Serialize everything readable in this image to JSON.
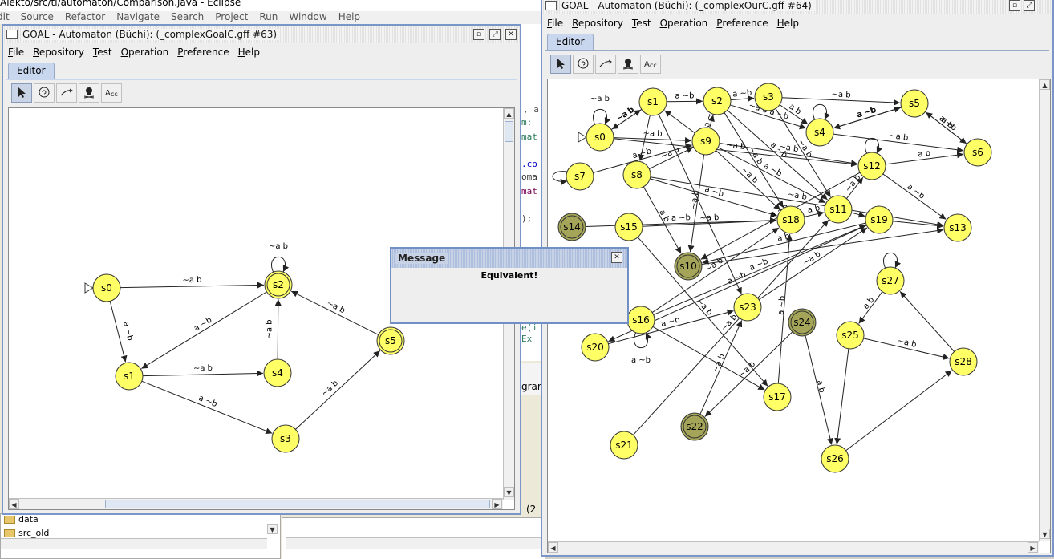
{
  "eclipse": {
    "title": "Alekto/src/tl/automaton/Comparison.java - Eclipse",
    "menu": [
      "dit",
      "Source",
      "Refactor",
      "Navigate",
      "Search",
      "Project",
      "Run",
      "Window",
      "Help"
    ],
    "code_fragments": [
      ", a",
      "m:",
      "mat",
      ".co",
      "oma",
      "mat",
      ");",
      "e(i",
      "Ex"
    ],
    "explorer_items": [
      "data",
      "src_old"
    ],
    "console_tab": "gram",
    "status_fragment": "(2"
  },
  "left_window": {
    "title": "GOAL - Automaton (Büchi): (_complexGoalC.gff #63)",
    "menu": [
      "File",
      "Repository",
      "Test",
      "Operation",
      "Preference",
      "Help"
    ],
    "tab": "Editor",
    "tools": [
      "pointer-icon",
      "state-icon",
      "transition-icon",
      "skull-icon",
      "text-tool-icon"
    ],
    "graph": {
      "states": [
        {
          "id": "s0",
          "initial": true,
          "accepting": false
        },
        {
          "id": "s1",
          "initial": false,
          "accepting": false
        },
        {
          "id": "s2",
          "initial": false,
          "accepting": true
        },
        {
          "id": "s3",
          "initial": false,
          "accepting": false
        },
        {
          "id": "s4",
          "initial": false,
          "accepting": false
        },
        {
          "id": "s5",
          "initial": false,
          "accepting": true
        }
      ],
      "transitions": [
        {
          "from": "s0",
          "to": "s2",
          "label": "~a b"
        },
        {
          "from": "s0",
          "to": "s1",
          "label": "a ~b"
        },
        {
          "from": "s2",
          "to": "s2",
          "label": "~a b"
        },
        {
          "from": "s2",
          "to": "s1",
          "label": "a ~b"
        },
        {
          "from": "s1",
          "to": "s4",
          "label": "~a b"
        },
        {
          "from": "s4",
          "to": "s2",
          "label": "~a b"
        },
        {
          "from": "s1",
          "to": "s3",
          "label": "a ~b"
        },
        {
          "from": "s3",
          "to": "s5",
          "label": "~a b"
        },
        {
          "from": "s5",
          "to": "s2",
          "label": "~a b"
        }
      ]
    }
  },
  "message_dialog": {
    "title": "Message",
    "text": "Equivalent!"
  },
  "right_window": {
    "title": "GOAL - Automaton (Büchi): (_complexOurC.gff #64)",
    "menu": [
      "File",
      "Repository",
      "Test",
      "Operation",
      "Preference",
      "Help"
    ],
    "tab": "Editor",
    "tools": [
      "pointer-icon",
      "state-icon",
      "transition-icon",
      "skull-icon",
      "text-tool-icon"
    ],
    "graph": {
      "states": [
        "s0",
        "s1",
        "s2",
        "s3",
        "s4",
        "s5",
        "s6",
        "s7",
        "s8",
        "s9",
        "s10",
        "s11",
        "s12",
        "s13",
        "s14",
        "s15",
        "s16",
        "s17",
        "s18",
        "s19",
        "s20",
        "s21",
        "s22",
        "s23",
        "s24",
        "s25",
        "s26",
        "s27",
        "s28"
      ],
      "dark_states": [
        "s10",
        "s14",
        "s22",
        "s24"
      ],
      "labels": [
        "~a b",
        "a ~b",
        "a ~b",
        "~a b",
        "~a b a ~b",
        "a ~b",
        "a b",
        "a ~b",
        "~a b",
        "a ~b",
        "~a b",
        "a b",
        "a ~b",
        "~a b",
        "~a b",
        "a b",
        "~a b",
        "~a b",
        "a ~b",
        "a b",
        "a ~b",
        "~a b",
        "~a b",
        "a ~b",
        "~a b",
        "a ~b",
        "~a b",
        "a ~b",
        "~a b",
        "a ~b",
        "a b",
        "~a b",
        "~a b",
        "a ~b",
        "~a b",
        "a ~b",
        "~a b",
        "a b",
        "a ~b",
        "~a b",
        "a ~b",
        "~a b",
        "~a b",
        "a ~b",
        "a b",
        "~a b",
        "a b",
        "~a b"
      ]
    }
  },
  "colors": {
    "state_fill": "#ffff66",
    "dark_state_fill": "#a5a55a",
    "title_bar_border": "#7a96c8",
    "tab_fill": "#c8d7ee"
  }
}
